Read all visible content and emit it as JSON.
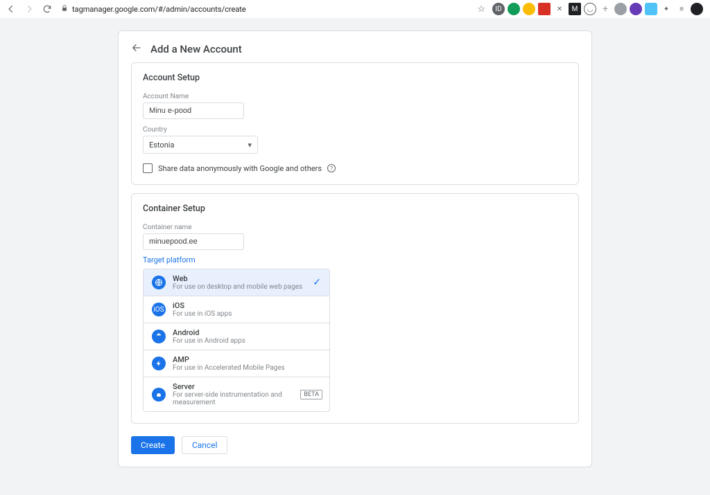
{
  "browser": {
    "url": "tagmanager.google.com/#/admin/accounts/create"
  },
  "header": {
    "title": "Add a New Account"
  },
  "account": {
    "section_title": "Account Setup",
    "name_label": "Account Name",
    "name_value": "Minu e-pood",
    "country_label": "Country",
    "country_value": "Estonia",
    "share_label": "Share data anonymously with Google and others"
  },
  "container": {
    "section_title": "Container Setup",
    "name_label": "Container name",
    "name_value": "minuepood.ee",
    "target_label": "Target platform",
    "platforms": [
      {
        "title": "Web",
        "desc": "For use on desktop and mobile web pages",
        "selected": true
      },
      {
        "title": "iOS",
        "desc": "For use in iOS apps"
      },
      {
        "title": "Android",
        "desc": "For use in Android apps"
      },
      {
        "title": "AMP",
        "desc": "For use in Accelerated Mobile Pages"
      },
      {
        "title": "Server",
        "desc": "For server-side instrumentation and measurement",
        "badge": "BETA"
      }
    ]
  },
  "actions": {
    "create": "Create",
    "cancel": "Cancel"
  }
}
